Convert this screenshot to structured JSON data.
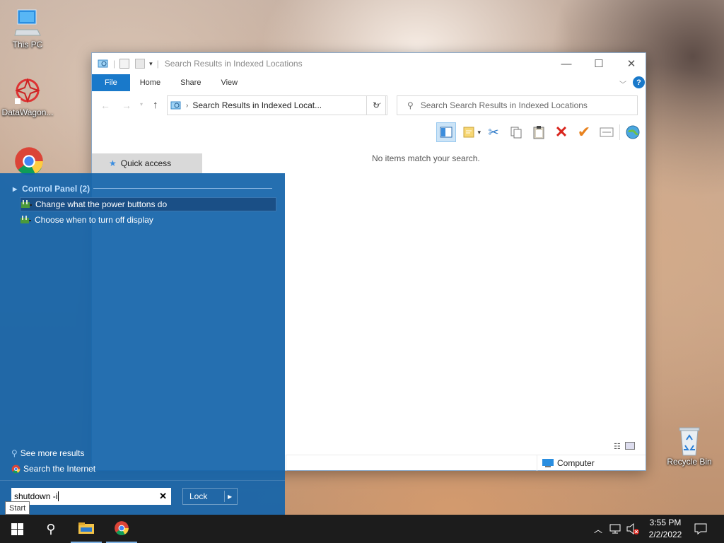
{
  "desktop": {
    "icons": [
      {
        "label": "This PC",
        "icon": "computer-icon"
      },
      {
        "label": "DataWagon...",
        "icon": "datawagon-icon"
      },
      {
        "label": "",
        "icon": "chrome-icon"
      },
      {
        "label": "Recycle Bin",
        "icon": "recycle-bin-icon"
      }
    ]
  },
  "explorer": {
    "title": "Search Results in Indexed Locations",
    "tabs": [
      "File",
      "Home",
      "Share",
      "View"
    ],
    "address": "Search Results in Indexed Locat...",
    "search_placeholder": "Search Search Results in Indexed Locations",
    "quick_access": "Quick access",
    "empty_message": "No items match your search.",
    "status_location": "Computer"
  },
  "start_menu": {
    "group_header": "Control Panel (2)",
    "results": [
      {
        "label": "Change what the power buttons do",
        "selected": true
      },
      {
        "label": "Choose when to turn off display",
        "selected": false
      }
    ],
    "see_more": "See more results",
    "search_internet": "Search the Internet",
    "search_value": "shutdown -i",
    "power_button": "Lock"
  },
  "tooltip": "Start",
  "taskbar": {
    "time": "3:55 PM",
    "date": "2/2/2022"
  },
  "colors": {
    "accent": "#1979ca",
    "start_bg": "#1464aa",
    "taskbar": "#1c1c1c",
    "delete_red": "#d9251d",
    "check_orange": "#e8821e"
  }
}
